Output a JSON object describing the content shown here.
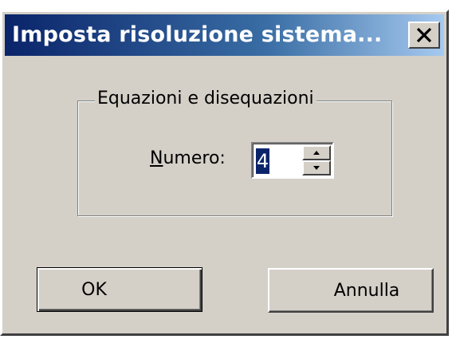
{
  "dialog": {
    "title": "Imposta risoluzione sistema...",
    "close_glyph": "×",
    "close_icon": "close-icon"
  },
  "group": {
    "legend": "Equazioni e disequazioni",
    "numero_label_mnemonic": "N",
    "numero_label_rest": "umero:",
    "numero_value": "4",
    "spin_up_icon": "arrow-up-icon",
    "spin_down_icon": "arrow-down-icon"
  },
  "buttons": {
    "ok_label": "OK",
    "cancel_label": "Annulla"
  },
  "colors": {
    "titlebar_start": "#0a246a",
    "titlebar_end": "#a6caf0",
    "face": "#d4d0c8",
    "selection": "#0a246a"
  }
}
